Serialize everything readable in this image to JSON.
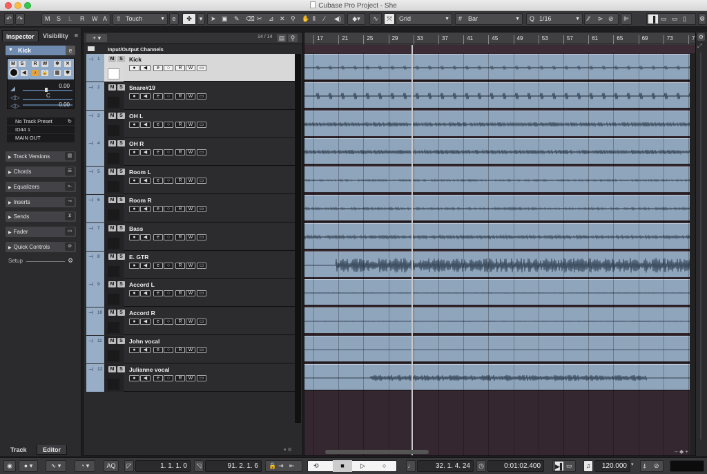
{
  "window": {
    "title": "Cubase Pro Project - She"
  },
  "toolbar": {
    "msrwa": [
      "M",
      "S",
      "L",
      "R",
      "W",
      "A"
    ],
    "automation_mode": "Touch",
    "snap_type": "Grid",
    "grid_type": "Bar",
    "quantize": "1/16"
  },
  "inspector": {
    "tabs": [
      "Inspector",
      "Visibility"
    ],
    "track_name": "Kick",
    "volume_value": "0.00",
    "pan_value": "C",
    "delay_value": "0.00",
    "preset": "No Track Preset",
    "input": "ID44 1",
    "output": "MAIN OUT",
    "sections": [
      "Track Versions",
      "Chords",
      "Equalizers",
      "Inserts",
      "Sends",
      "Fader",
      "Quick Controls"
    ],
    "setup_label": "Setup",
    "bottom_tabs": [
      "Track",
      "Editor"
    ]
  },
  "tracklist": {
    "count_label": "14 / 14",
    "io_label": "Input/Output Channels",
    "tracks": [
      {
        "num": "1",
        "name": "Kick"
      },
      {
        "num": "2",
        "name": "Snare#19"
      },
      {
        "num": "3",
        "name": "OH L"
      },
      {
        "num": "4",
        "name": "OH R"
      },
      {
        "num": "5",
        "name": "Room L"
      },
      {
        "num": "6",
        "name": "Room R"
      },
      {
        "num": "7",
        "name": "Bass"
      },
      {
        "num": "8",
        "name": "E. GTR"
      },
      {
        "num": "9",
        "name": "Accord L"
      },
      {
        "num": "10",
        "name": "Accord R"
      },
      {
        "num": "11",
        "name": "John vocal"
      },
      {
        "num": "12",
        "name": "Julianne vocal"
      }
    ]
  },
  "ruler": {
    "bars": [
      "17",
      "21",
      "25",
      "29",
      "33",
      "37",
      "41",
      "45",
      "49",
      "53",
      "57",
      "61",
      "65",
      "69",
      "73",
      "7"
    ]
  },
  "transport": {
    "left_locator": "1. 1. 1. 0",
    "right_locator": "91. 2. 1. 6",
    "position_bars": "32. 1. 4. 24",
    "position_time": "0:01:02.400",
    "tempo": "120.000",
    "aq": "AQ"
  }
}
